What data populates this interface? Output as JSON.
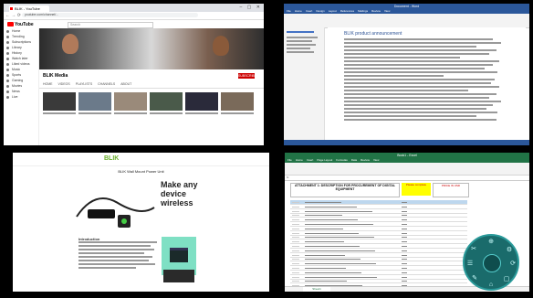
{
  "browser": {
    "tab_title": "BLIK - YouTube",
    "url": "youtube.com/channel/...",
    "search_placeholder": "Search",
    "channel_name": "BLIK Media",
    "subscribe_label": "SUBSCRIBE",
    "tabs": [
      "HOME",
      "VIDEOS",
      "PLAYLISTS",
      "CHANNELS",
      "ABOUT"
    ],
    "sidebar": [
      "Home",
      "Trending",
      "Subscriptions",
      "Library",
      "History",
      "Watch later",
      "Liked videos",
      "Music",
      "Sports",
      "Gaming",
      "Movies",
      "News",
      "Live"
    ]
  },
  "word": {
    "title": "Document - Word",
    "ribbon_tabs": [
      "File",
      "Home",
      "Insert",
      "Design",
      "Layout",
      "References",
      "Mailings",
      "Review",
      "View"
    ],
    "heading": "BLIK product announcement"
  },
  "web": {
    "logo": "BLIK",
    "page_title": "BLIK Wall Mount Power Unit",
    "ad_text": "Make any device wireless",
    "section_heading": "Introduction"
  },
  "excel": {
    "title": "Book1 - Excel",
    "ribbon_tabs": [
      "File",
      "Home",
      "Insert",
      "Page Layout",
      "Formulas",
      "Data",
      "Review",
      "View"
    ],
    "header": "ATTACHMENT 1: DESCRIPTION FOR PROCUREMENT OF DIGITAL EQUIPMENT",
    "yellow_note": "Please complete",
    "red_note": "PRICE IN USD",
    "sheet_tab": "Sheet1"
  }
}
